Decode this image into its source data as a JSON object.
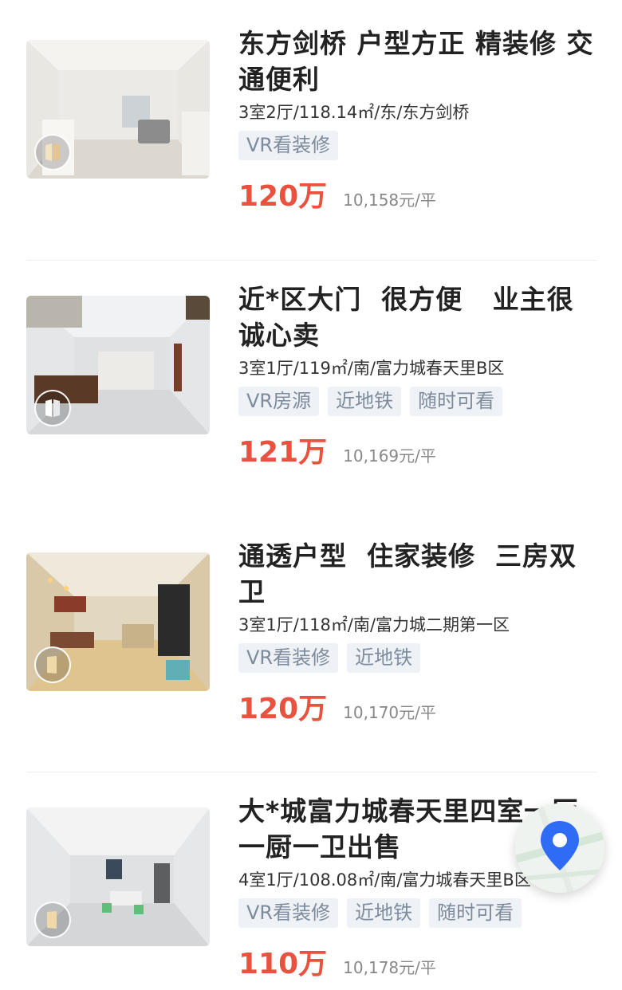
{
  "listings": [
    {
      "title": "东方剑桥 户型方正 精装修 交通便利",
      "meta": "3室2厅/118.14㎡/东/东方剑桥",
      "tags": [
        "VR看装修"
      ],
      "price": "120万",
      "unit_price": "10,158元/平"
    },
    {
      "title": "近*区大门  很方便   业主很诚心卖",
      "meta": "3室1厅/119㎡/南/富力城春天里B区",
      "tags": [
        "VR房源",
        "近地铁",
        "随时可看"
      ],
      "price": "121万",
      "unit_price": "10,169元/平"
    },
    {
      "title": "通透户型  住家装修  三房双卫",
      "meta": "3室1厅/118㎡/南/富力城二期第一区",
      "tags": [
        "VR看装修",
        "近地铁"
      ],
      "price": "120万",
      "unit_price": "10,170元/平"
    },
    {
      "title": "大*城富力城春天里四室一厅一厨一卫出售",
      "meta": "4室1厅/108.08㎡/南/富力城春天里B区",
      "tags": [
        "VR看装修",
        "近地铁",
        "随时可看"
      ],
      "price": "110万",
      "unit_price": "10,178元/平"
    }
  ],
  "icons": {
    "vr": "vr-icon",
    "map": "map-location-icon"
  },
  "colors": {
    "price": "#e8523f",
    "tag_bg": "#eef2f6",
    "tag_text": "#7d8b9c",
    "map_pin": "#2f6cf6"
  }
}
